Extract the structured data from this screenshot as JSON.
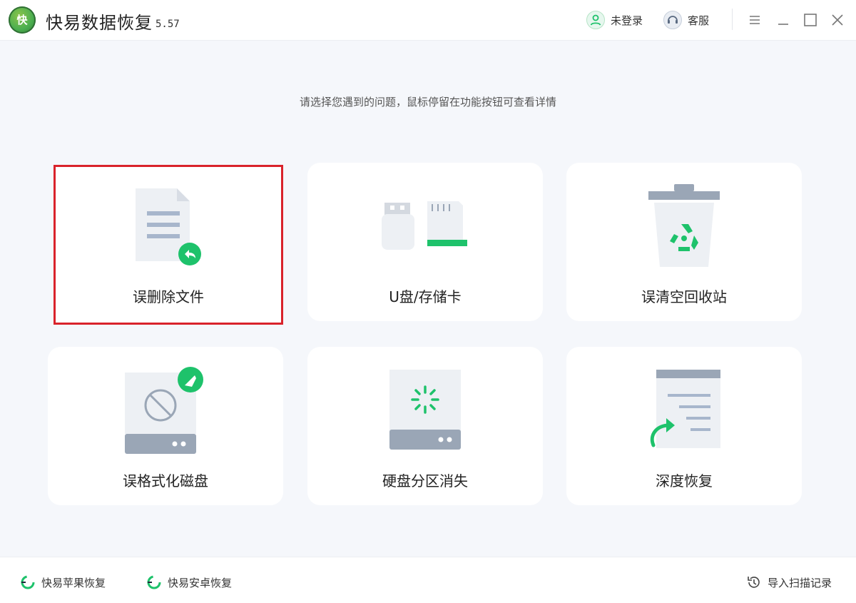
{
  "app": {
    "title": "快易数据恢复",
    "version": "5.57",
    "logo_text": "快"
  },
  "header": {
    "login_label": "未登录",
    "service_label": "客服",
    "menu_icon": "menu-icon",
    "minimize_icon": "minimize-icon",
    "maximize_icon": "maximize-icon",
    "close_icon": "close-icon"
  },
  "main": {
    "prompt": "请选择您遇到的问题，鼠标停留在功能按钮可查看详情",
    "cards": [
      {
        "label": "误删除文件",
        "icon": "document-restore-icon",
        "selected": true
      },
      {
        "label": "U盘/存储卡",
        "icon": "usb-sdcard-icon",
        "selected": false
      },
      {
        "label": "误清空回收站",
        "icon": "recycle-bin-icon",
        "selected": false
      },
      {
        "label": "误格式化磁盘",
        "icon": "format-disk-icon",
        "selected": false
      },
      {
        "label": "硬盘分区消失",
        "icon": "partition-disk-icon",
        "selected": false
      },
      {
        "label": "深度恢复",
        "icon": "deep-recovery-icon",
        "selected": false
      }
    ]
  },
  "footer": {
    "apple_recovery": "快易苹果恢复",
    "android_recovery": "快易安卓恢复",
    "import_scan": "导入扫描记录"
  },
  "colors": {
    "accent_green": "#1ec26b",
    "selected_border": "#d9232b",
    "card_bg": "#ffffff",
    "page_bg": "#f5f7fb"
  }
}
